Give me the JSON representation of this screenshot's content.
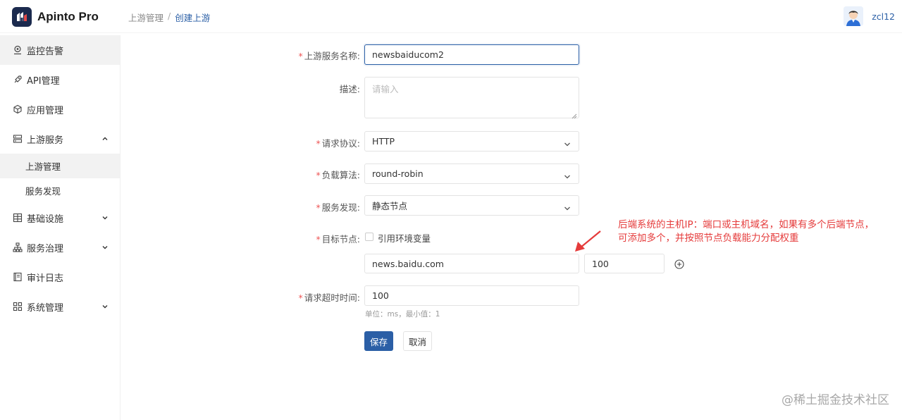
{
  "app": {
    "title": "Apinto Pro"
  },
  "breadcrumb": {
    "parent": "上游管理",
    "separator": "/",
    "current": "创建上游"
  },
  "user": {
    "name": "zcl12"
  },
  "sidebar": {
    "items": [
      {
        "label": "监控告警",
        "icon": "monitor-pin-icon"
      },
      {
        "label": "API管理",
        "icon": "rocket-icon"
      },
      {
        "label": "应用管理",
        "icon": "cube-icon"
      },
      {
        "label": "上游服务",
        "icon": "server-icon",
        "expanded": true,
        "children": [
          {
            "label": "上游管理"
          },
          {
            "label": "服务发现"
          }
        ]
      },
      {
        "label": "基础设施",
        "icon": "grid-table-icon"
      },
      {
        "label": "服务治理",
        "icon": "org-chart-icon"
      },
      {
        "label": "审计日志",
        "icon": "log-book-icon"
      },
      {
        "label": "系统管理",
        "icon": "apps-grid-icon"
      }
    ]
  },
  "form": {
    "name": {
      "label": "上游服务名称:",
      "value": "newsbaiducom2",
      "required": true
    },
    "description": {
      "label": "描述:",
      "placeholder": "请输入"
    },
    "protocol": {
      "label": "请求协议:",
      "value": "HTTP",
      "required": true
    },
    "algorithm": {
      "label": "负载算法:",
      "value": "round-robin",
      "required": true
    },
    "discovery": {
      "label": "服务发现:",
      "value": "静态节点",
      "required": true
    },
    "target": {
      "label": "目标节点:",
      "required": true,
      "checkbox_label": "引用环境变量",
      "node_address": "news.baidu.com",
      "node_weight": "100"
    },
    "timeout": {
      "label": "请求超时时间:",
      "value": "100",
      "required": true,
      "hint": "单位：ms，最小值：1"
    },
    "save_label": "保存",
    "cancel_label": "取消"
  },
  "annotation": {
    "line1": "后端系统的主机IP：端口或主机域名，如果有多个后端节点，",
    "line2": "可添加多个，并按照节点负载能力分配权重"
  },
  "watermark": "@稀土掘金技术社区",
  "colors": {
    "primary": "#2b5fa6",
    "required": "#e55555",
    "annotation": "#e53b3b"
  }
}
